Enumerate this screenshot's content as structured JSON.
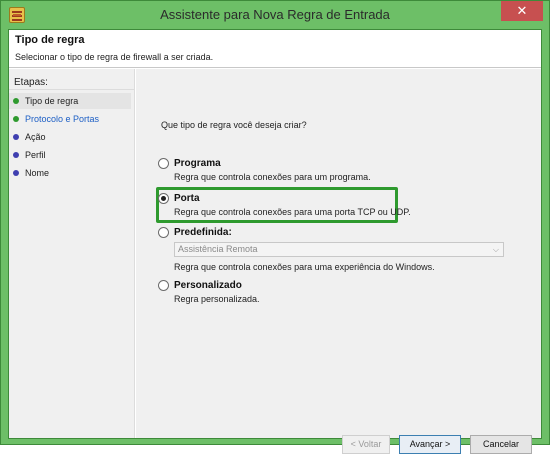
{
  "window": {
    "title": "Assistente para Nova Regra de Entrada",
    "close_label": "✕"
  },
  "header": {
    "title": "Tipo de regra",
    "subtitle": "Selecionar o tipo de regra de firewall a ser criada."
  },
  "steps": {
    "heading": "Etapas:",
    "items": [
      {
        "label": "Tipo de regra",
        "status": "completed"
      },
      {
        "label": "Protocolo e Portas",
        "status": "current"
      },
      {
        "label": "Ação",
        "status": "pending"
      },
      {
        "label": "Perfil",
        "status": "pending"
      },
      {
        "label": "Nome",
        "status": "pending"
      }
    ]
  },
  "main": {
    "question": "Que tipo de regra você deseja criar?",
    "options": [
      {
        "label": "Programa",
        "description": "Regra que controla conexões para um programa.",
        "checked": false
      },
      {
        "label": "Porta",
        "description": "Regra que controla conexões para uma porta TCP ou UDP.",
        "checked": true
      },
      {
        "label": "Predefinida:",
        "description": "Regra que controla conexões para uma experiência do Windows.",
        "checked": false
      },
      {
        "label": "Personalizado",
        "description": "Regra personalizada.",
        "checked": false
      }
    ],
    "predefined_select": {
      "value": "Assistência Remota"
    }
  },
  "buttons": {
    "back": "< Voltar",
    "next": "Avançar >",
    "cancel": "Cancelar"
  },
  "colors": {
    "frame": "#6dbf67",
    "highlight": "#2e9a2e",
    "link": "#1d5fc5"
  }
}
